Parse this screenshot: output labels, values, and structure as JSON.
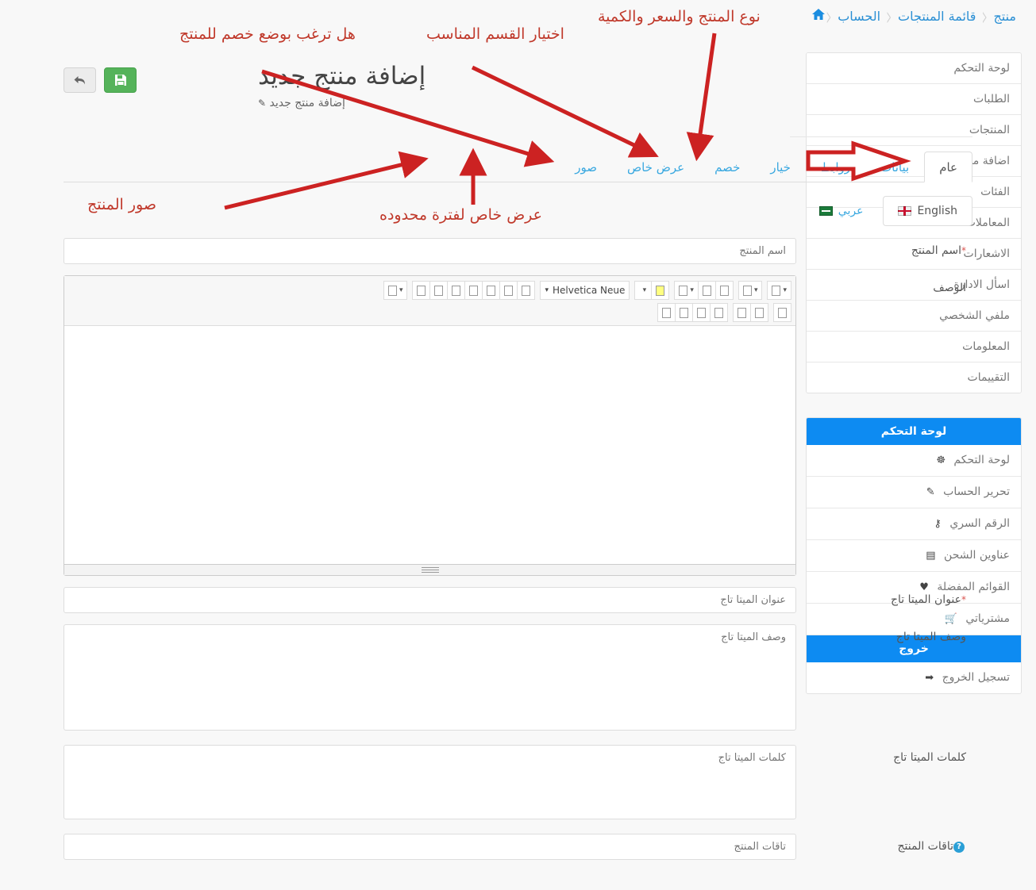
{
  "breadcrumb": {
    "home_icon": "home-icon",
    "items": [
      {
        "label": "الحساب"
      },
      {
        "label": "قائمة المنتجات"
      },
      {
        "label": "منتج"
      }
    ],
    "separator": "‹"
  },
  "toolbar": {
    "back_label": "↩",
    "save_label": "💾"
  },
  "header": {
    "title": "إضافة منتج جديد",
    "subtitle": "إضافة منتج جديد",
    "pen_icon": "✎"
  },
  "tabs": [
    {
      "label": "عام",
      "active": true
    },
    {
      "label": "بيانات",
      "active": false
    },
    {
      "label": "روابط",
      "active": false
    },
    {
      "label": "خيار",
      "active": false
    },
    {
      "label": "خصم",
      "active": false
    },
    {
      "label": "عرض خاص",
      "active": false
    },
    {
      "label": "صور",
      "active": false
    }
  ],
  "languages": [
    {
      "label": "English",
      "flag": "uk-flag",
      "active": true
    },
    {
      "label": "عربي",
      "flag": "saudi-flag",
      "active": false
    }
  ],
  "form": {
    "product_name": {
      "label": "اسم المنتج",
      "required": true,
      "placeholder": "اسم المنتج",
      "value": ""
    },
    "description": {
      "label": "الوصف",
      "required": false,
      "font_name": "Helvetica Neue"
    },
    "meta_title": {
      "label": "عنوان الميتا تاج",
      "required": true,
      "placeholder": "عنوان الميتا تاج",
      "value": ""
    },
    "meta_description": {
      "label": "وصف الميتا تاج",
      "required": false,
      "placeholder": "وصف الميتا تاج",
      "value": ""
    },
    "meta_keywords": {
      "label": "كلمات الميتا تاج",
      "required": false,
      "placeholder": "كلمات الميتا تاج",
      "value": ""
    },
    "product_tags": {
      "label": "تاقات المنتج",
      "required": false,
      "help": "?",
      "placeholder": "تاقات المنتج",
      "value": ""
    }
  },
  "sidebar": {
    "menu": [
      {
        "label": "لوحة التحكم"
      },
      {
        "label": "الطلبات"
      },
      {
        "label": "المنتجات"
      },
      {
        "label": "اضافة منتج"
      },
      {
        "label": "الفئات"
      },
      {
        "label": "المعاملات"
      },
      {
        "label": "الاشعارات"
      },
      {
        "label": "اسأل الادارة"
      },
      {
        "label": "ملفي الشخصي"
      },
      {
        "label": "المعلومات"
      },
      {
        "label": "التقييمات"
      }
    ],
    "account_panel": {
      "title": "لوحة التحكم",
      "items": [
        {
          "label": "لوحة التحكم",
          "icon": "dashboard-icon",
          "glyph": "☸"
        },
        {
          "label": "تحرير الحساب",
          "icon": "pencil-icon",
          "glyph": "✎"
        },
        {
          "label": "الرقم السري",
          "icon": "key-icon",
          "glyph": "⚷"
        },
        {
          "label": "عناوين الشحن",
          "icon": "book-icon",
          "glyph": "▤"
        },
        {
          "label": "القوائم المفضلة",
          "icon": "heart-icon",
          "glyph": "♥"
        },
        {
          "label": "مشترياتي",
          "icon": "cart-icon",
          "glyph": "🛒"
        }
      ]
    },
    "logout_panel": {
      "title": "خروج",
      "items": [
        {
          "label": "تسجيل الخروج",
          "icon": "signout-icon",
          "glyph": "➡"
        }
      ]
    }
  },
  "annotations": [
    {
      "text": "نوع المنتج والسعر والكمية",
      "name": "annotation-product-type-price-qty"
    },
    {
      "text": "اختيار القسم المناسب",
      "name": "annotation-choose-category"
    },
    {
      "text": "هل ترغب بوضع خصم للمنتج",
      "name": "annotation-discount"
    },
    {
      "text": "عرض خاص لفترة محدوده",
      "name": "annotation-special-offer"
    },
    {
      "text": "صور المنتج",
      "name": "annotation-product-images"
    }
  ],
  "colors": {
    "accent_blue": "#0d8bf2",
    "link_blue": "#39a8e0",
    "annotation_red": "#c0392b",
    "save_green": "#55b35a",
    "required_red": "#d9534f"
  }
}
